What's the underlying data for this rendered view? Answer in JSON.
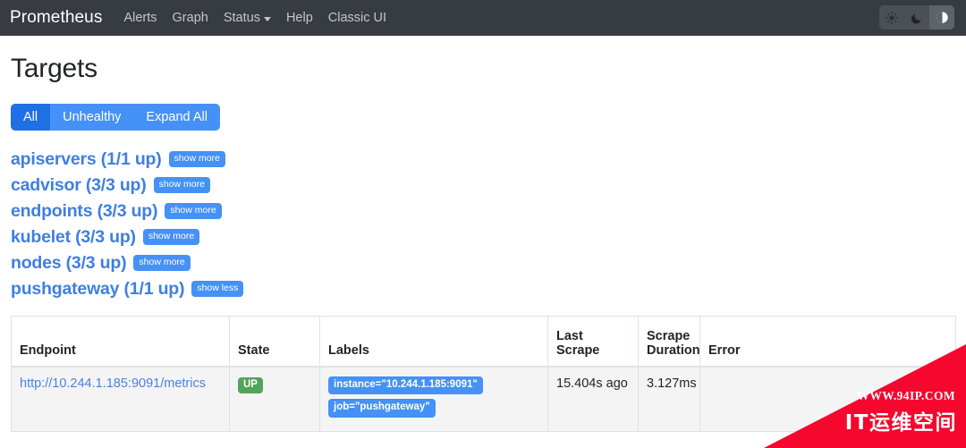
{
  "navbar": {
    "brand": "Prometheus",
    "links": [
      {
        "label": "Alerts",
        "has_caret": false
      },
      {
        "label": "Graph",
        "has_caret": false
      },
      {
        "label": "Status",
        "has_caret": true
      },
      {
        "label": "Help",
        "has_caret": false
      },
      {
        "label": "Classic UI",
        "has_caret": false
      }
    ],
    "theme": {
      "light_icon": "sun-icon",
      "dark_icon": "moon-icon",
      "auto_icon": "half-circle-icon",
      "selected": "auto"
    }
  },
  "page": {
    "title": "Targets"
  },
  "filters": {
    "buttons": [
      {
        "label": "All",
        "active": true
      },
      {
        "label": "Unhealthy",
        "active": false
      },
      {
        "label": "Expand All",
        "active": false
      }
    ]
  },
  "jobs": [
    {
      "name": "apiservers (1/1 up)",
      "toggle": "show more",
      "expanded": false
    },
    {
      "name": "cadvisor (3/3 up)",
      "toggle": "show more",
      "expanded": false
    },
    {
      "name": "endpoints (3/3 up)",
      "toggle": "show more",
      "expanded": false
    },
    {
      "name": "kubelet (3/3 up)",
      "toggle": "show more",
      "expanded": false
    },
    {
      "name": "nodes (3/3 up)",
      "toggle": "show more",
      "expanded": false
    },
    {
      "name": "pushgateway (1/1 up)",
      "toggle": "show less",
      "expanded": true
    }
  ],
  "table": {
    "headers": {
      "endpoint": "Endpoint",
      "state": "State",
      "labels": "Labels",
      "last_scrape": "Last Scrape",
      "scrape_duration": "Scrape Duration",
      "error": "Error"
    },
    "rows": [
      {
        "endpoint": "http://10.244.1.185:9091/metrics",
        "state": "UP",
        "labels": [
          "instance=\"10.244.1.185:9091\"",
          "job=\"pushgateway\""
        ],
        "last_scrape": "15.404s ago",
        "scrape_duration": "3.127ms",
        "error": ""
      }
    ]
  },
  "watermark": {
    "url": "WWW.94IP.COM",
    "text": "IT运维空间",
    "color": "#f5072e"
  },
  "colors": {
    "navbar_bg": "#373c42",
    "primary_blue": "#4591f7",
    "active_blue": "#1f6fe5",
    "up_green": "#52a45b",
    "link_blue": "#3f7fe0"
  }
}
